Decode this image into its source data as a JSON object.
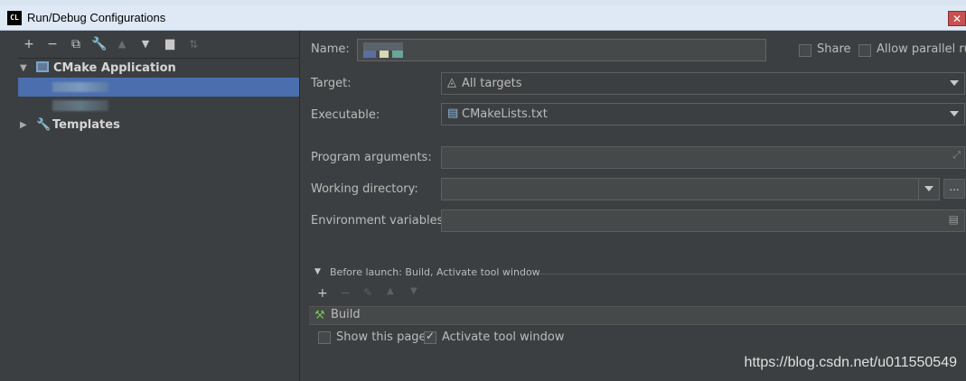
{
  "window": {
    "app_icon": "CL",
    "title": "Run/Debug Configurations",
    "close_glyph": "✕"
  },
  "toolbar": {
    "icons": [
      "plus-icon",
      "minus-icon",
      "copy-icon",
      "wrench-icon",
      "arrow-up-icon",
      "arrow-down-icon",
      "new-folder-icon",
      "sort-icon"
    ]
  },
  "tree": {
    "group_label": "CMake Application",
    "templates_label": "Templates"
  },
  "form": {
    "name_label": "Name:",
    "share_label": "Share",
    "allow_parallel_label": "Allow parallel run",
    "target_label": "Target:",
    "target_value": "All targets",
    "executable_label": "Executable:",
    "executable_value": "CMakeLists.txt",
    "program_args_label": "Program arguments:",
    "working_dir_label": "Working directory:",
    "env_vars_label": "Environment variables:",
    "browse_button": "..."
  },
  "before_launch": {
    "header": "Before launch: Build, Activate tool window",
    "items": [
      "Build"
    ],
    "show_this_page_label": "Show this page",
    "show_this_page_checked": false,
    "activate_tool_window_label": "Activate tool window",
    "activate_tool_window_checked": true
  },
  "watermark": "https://blog.csdn.net/u011550549",
  "colors": {
    "background": "#3c3f41",
    "selection": "#4b6eaf",
    "field": "#45494a"
  }
}
